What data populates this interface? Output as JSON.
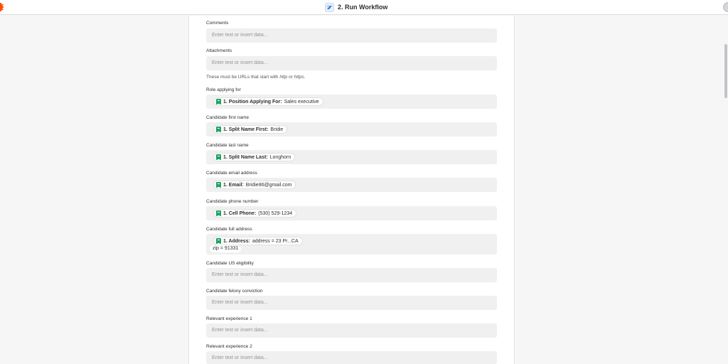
{
  "header": {
    "title": "2. Run Workflow"
  },
  "fields": {
    "comments": {
      "label": "Comments",
      "placeholder": "Enter text or insert data..."
    },
    "attachments": {
      "label": "Attachments",
      "placeholder": "Enter text or insert data...",
      "hint_prefix": "These must be URLs that start with ",
      "hint_http": "http",
      "hint_or": " or ",
      "hint_https": "https",
      "hint_suffix": "."
    },
    "role": {
      "label": "Role applying for",
      "pill_key": "1. Position Applying For:",
      "pill_value": " Sales executive"
    },
    "first_name": {
      "label": "Candidate first name",
      "pill_key": "1. Split Name First:",
      "pill_value": " Bridie"
    },
    "last_name": {
      "label": "Candidate last name",
      "pill_key": "1. Split Name Last:",
      "pill_value": " Longhorn"
    },
    "email": {
      "label": "Candidate email address",
      "pill_key": "1. Email:",
      "pill_value": " Bridie86@gmail.com"
    },
    "phone": {
      "label": "Candidate phone number",
      "pill_key": "1. Cell Phone:",
      "pill_value": " (530) 529-1234"
    },
    "address": {
      "label": "Candidate full address",
      "pill_key": "1. Address:",
      "pill_value": " address = 23 Pr...CA",
      "pill_value_line2": "zip = 91331"
    },
    "us_eligibility": {
      "label": "Candidate US eligibility",
      "placeholder": "Enter text or insert data..."
    },
    "felony": {
      "label": "Candidate felony conviction",
      "placeholder": "Enter text or insert data..."
    },
    "experience1": {
      "label": "Relevant experience 1",
      "placeholder": "Enter text or insert data..."
    },
    "experience2": {
      "label": "Relevant experience 2",
      "placeholder": "Enter text or insert data..."
    }
  },
  "colors": {
    "accent_logo": "#ff4a00",
    "sheets_green": "#1fa463",
    "field_bg": "#f0f0f0"
  },
  "icons": {
    "app": "workflow-app-icon",
    "data_pill": "google-sheets-icon"
  }
}
